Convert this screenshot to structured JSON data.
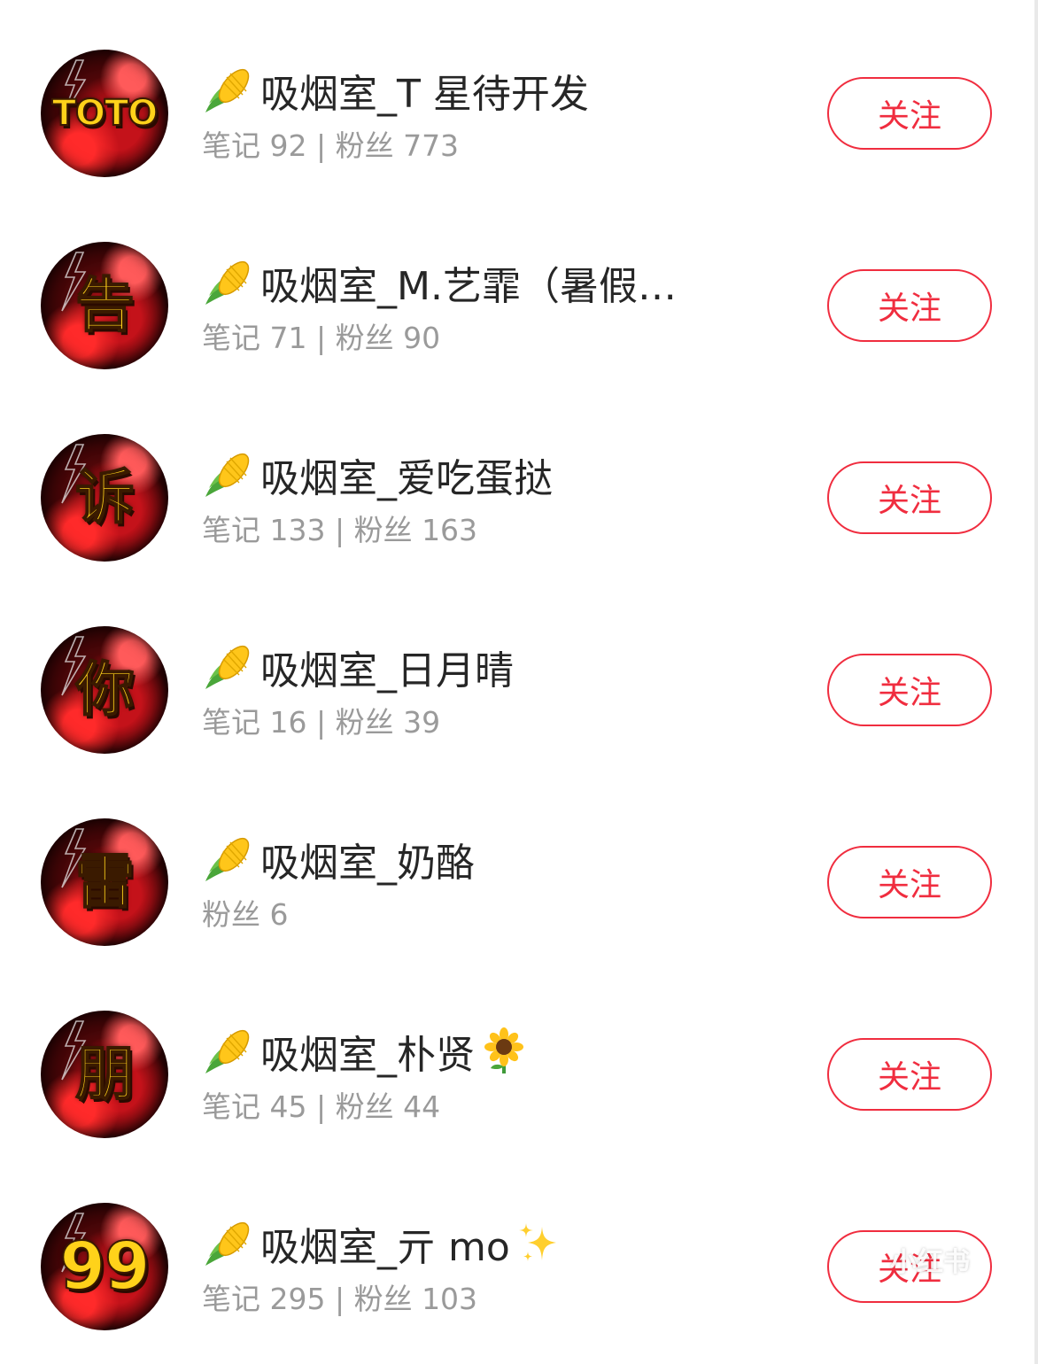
{
  "follow_label": "关注",
  "watermark": "小红书",
  "colors": {
    "accent": "#f02d3f",
    "name_text": "#262626",
    "stats_text": "#9a9a9a",
    "avatar_glyph": "#ffd21a"
  },
  "users": [
    {
      "avatar_text": "TOTO",
      "name": "吸烟室_T 星待开发",
      "stats": "笔记 92 | 粉丝 773",
      "name_icon": "corn-emoji"
    },
    {
      "avatar_text": "告",
      "name": "吸烟室_M.艺霏（暑假…",
      "stats": "笔记 71 | 粉丝 90",
      "name_icon": "corn-emoji"
    },
    {
      "avatar_text": "诉",
      "name": "吸烟室_爱吃蛋挞",
      "stats": "笔记 133 | 粉丝 163",
      "name_icon": "corn-emoji"
    },
    {
      "avatar_text": "你",
      "name": "吸烟室_日月晴",
      "stats": "笔记 16 | 粉丝 39",
      "name_icon": "corn-emoji"
    },
    {
      "avatar_text": "雷",
      "name": "吸烟室_奶酪",
      "stats": "粉丝 6",
      "name_icon": "corn-emoji"
    },
    {
      "avatar_text": "朋",
      "name": "吸烟室_朴贤",
      "stats": "笔记 45 | 粉丝 44",
      "name_icon": "corn-emoji",
      "trailing_icon": "sunflower-emoji"
    },
    {
      "avatar_text": "99",
      "name": "吸烟室_亓 mo",
      "stats": "笔记 295 | 粉丝 103",
      "name_icon": "corn-emoji",
      "trailing_icon": "sparkles-emoji"
    }
  ]
}
